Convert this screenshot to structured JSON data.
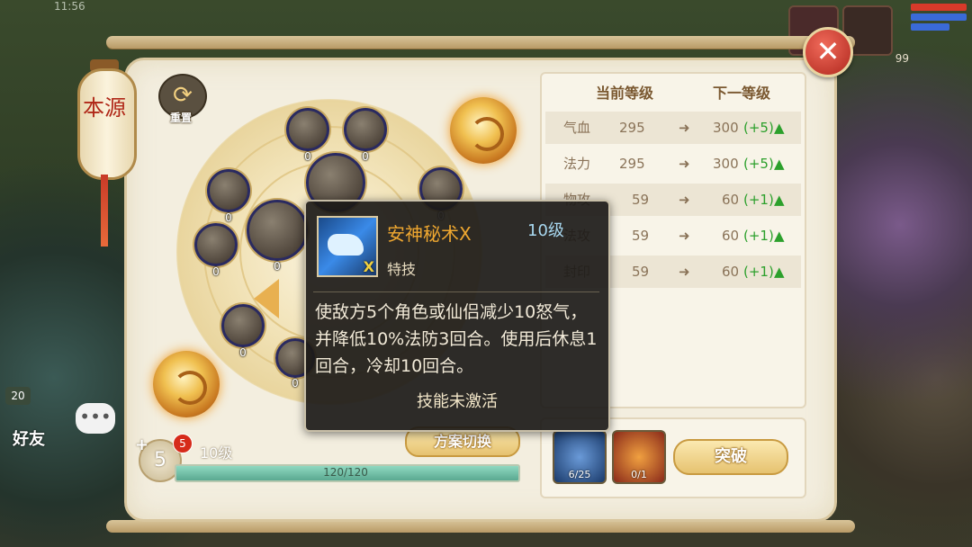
{
  "statusbar": {
    "time": "11:56"
  },
  "hud": {
    "slot_number": "99"
  },
  "lantern": {
    "text": "本源"
  },
  "reset": {
    "label": "重置"
  },
  "wheel": {
    "nodes": [
      {
        "id": "top-left",
        "lv": "0"
      },
      {
        "id": "top-right",
        "lv": "0"
      },
      {
        "id": "center-top",
        "lv": ""
      },
      {
        "id": "right",
        "lv": "0"
      },
      {
        "id": "left-upper",
        "lv": "0"
      },
      {
        "id": "left-mid",
        "lv": "0"
      },
      {
        "id": "center-left",
        "lv": "0"
      },
      {
        "id": "left-lower",
        "lv": "0"
      },
      {
        "id": "bottom-left",
        "lv": "0"
      }
    ]
  },
  "stats": {
    "col_current": "当前等级",
    "col_next": "下一等级",
    "rows": [
      {
        "name": "气血",
        "cur": "295",
        "next": "300",
        "gain": "(+5)"
      },
      {
        "name": "法力",
        "cur": "295",
        "next": "300",
        "gain": "(+5)"
      },
      {
        "name": "物攻",
        "cur": "59",
        "next": "60",
        "gain": "(+1)"
      },
      {
        "name": "法攻",
        "cur": "59",
        "next": "60",
        "gain": "(+1)"
      },
      {
        "name": "封印",
        "cur": "59",
        "next": "60",
        "gain": "(+1)"
      }
    ]
  },
  "breakthrough": {
    "mat1_count": "6/25",
    "mat2_count": "0/1",
    "button": "突破"
  },
  "scheme_button": "方案切换",
  "level": {
    "points": "5",
    "badge": "5",
    "label": "10级",
    "exp_text": "120/120",
    "exp_fraction": 1.0
  },
  "friend": {
    "tag": "20",
    "label": "好友"
  },
  "tooltip": {
    "name": "安神秘术X",
    "level": "10级",
    "type": "特技",
    "icon_badge": "X",
    "description": "使敌方5个角色或仙侣减少10怒气，并降低10%法防3回合。使用后休息1回合，冷却10回合。",
    "status": "技能未激活"
  },
  "colors": {
    "skill_name": "#f0a830",
    "gain": "#2ca02c",
    "accent_gold": "#e6c270"
  }
}
